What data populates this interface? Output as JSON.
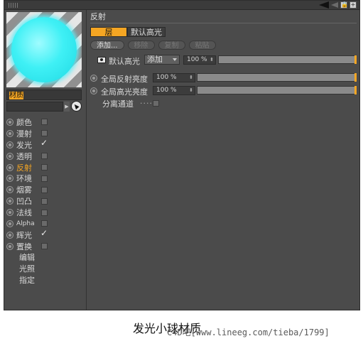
{
  "left_panel": {
    "material_name": "材质",
    "channels": [
      {
        "label": "颜色",
        "checked": false,
        "active": false
      },
      {
        "label": "漫射",
        "checked": false,
        "active": false
      },
      {
        "label": "发光",
        "checked": true,
        "active": false
      },
      {
        "label": "透明",
        "checked": false,
        "active": false
      },
      {
        "label": "反射",
        "checked": false,
        "active": true
      },
      {
        "label": "环境",
        "checked": false,
        "active": false
      },
      {
        "label": "烟雾",
        "checked": false,
        "active": false
      },
      {
        "label": "凹凸",
        "checked": false,
        "active": false
      },
      {
        "label": "法线",
        "checked": false,
        "active": false
      },
      {
        "label": "Alpha",
        "checked": false,
        "active": false
      },
      {
        "label": "辉光",
        "checked": true,
        "active": false
      },
      {
        "label": "置换",
        "checked": false,
        "active": false
      }
    ],
    "sub_items": [
      "编辑",
      "光照",
      "指定"
    ]
  },
  "reflection": {
    "section_title": "反射",
    "tabs": [
      "层",
      "默认高光"
    ],
    "buttons": [
      "添加...",
      "移除",
      "复制",
      "粘贴"
    ],
    "layer_name": "默认高光",
    "blend_mode": "添加",
    "layer_opacity": "100 %",
    "global_reflection_label": "全局反射亮度",
    "global_reflection_value": "100 %",
    "global_specular_label": "全局高光亮度",
    "global_specular_value": "100 %",
    "separate_pass_label": "分离通道",
    "separate_pass_dots": "....",
    "separate_pass_checked": false
  },
  "caption": {
    "title": "发光小球材质",
    "watermark": "C4D吧[www.lineeg.com/tieba/1799]"
  },
  "colors": {
    "panel_bg": "#4b4b4b",
    "accent": "#f5a623",
    "sphere": "#3ff0f5"
  }
}
